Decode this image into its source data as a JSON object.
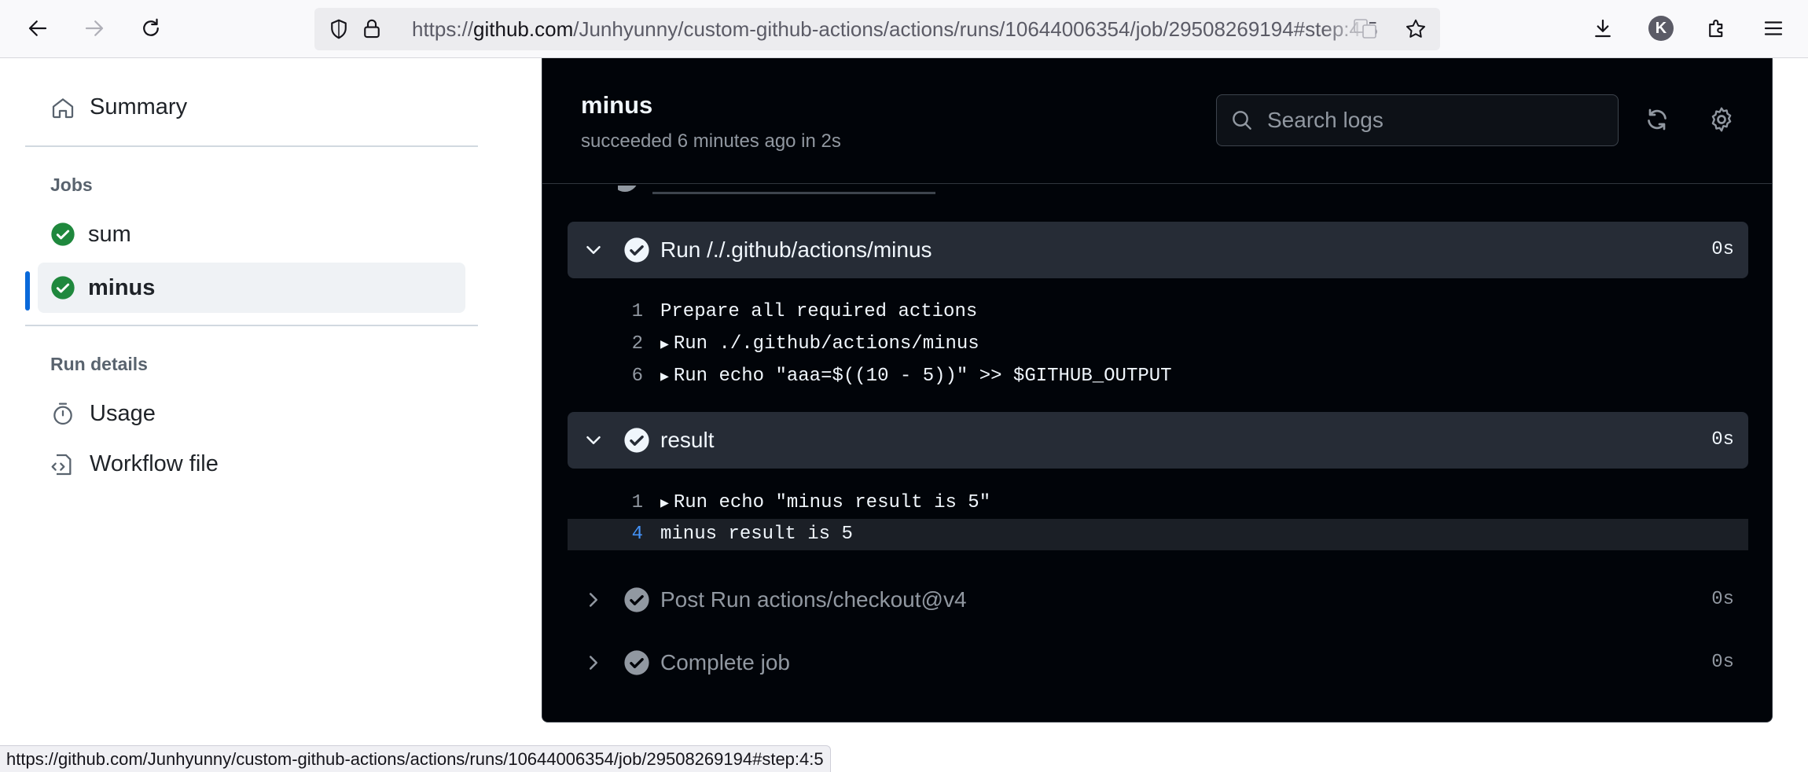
{
  "browser": {
    "url_prefix": "https://",
    "url_host": "github.com",
    "url_path": "/Junhyunny/custom-github-actions/actions/runs/10644006354/job/29508269194#step:4:5",
    "account_initial": "K"
  },
  "sidebar": {
    "summary_label": "Summary",
    "jobs_heading": "Jobs",
    "jobs": [
      {
        "name": "sum"
      },
      {
        "name": "minus"
      }
    ],
    "run_details_heading": "Run details",
    "usage_label": "Usage",
    "workflow_file_label": "Workflow file"
  },
  "job": {
    "title": "minus",
    "status": "succeeded 6 minutes ago in 2s",
    "search_placeholder": "Search logs"
  },
  "steps": [
    {
      "name": "Run /./.github/actions/minus",
      "duration": "0s",
      "expanded": true,
      "lines": [
        {
          "num": "1",
          "text": "Prepare all required actions",
          "collapsible": false
        },
        {
          "num": "2",
          "text": "Run ./.github/actions/minus",
          "collapsible": true
        },
        {
          "num": "6",
          "text": "Run echo \"aaa=$((10 - 5))\" >> $GITHUB_OUTPUT",
          "collapsible": true
        }
      ]
    },
    {
      "name": "result",
      "duration": "0s",
      "expanded": true,
      "lines": [
        {
          "num": "1",
          "text": "Run echo \"minus result is 5\"",
          "collapsible": true
        },
        {
          "num": "4",
          "text": "minus result is 5",
          "collapsible": false,
          "highlighted": true
        }
      ]
    },
    {
      "name": "Post Run actions/checkout@v4",
      "duration": "0s",
      "expanded": false
    },
    {
      "name": "Complete job",
      "duration": "0s",
      "expanded": false
    }
  ],
  "statusbar": {
    "text": "https://github.com/Junhyunny/custom-github-actions/actions/runs/10644006354/job/29508269194#step:4:5"
  },
  "colors": {
    "success_green": "#1f883d",
    "panel_bg": "#010409",
    "active_accent": "#0969da"
  }
}
